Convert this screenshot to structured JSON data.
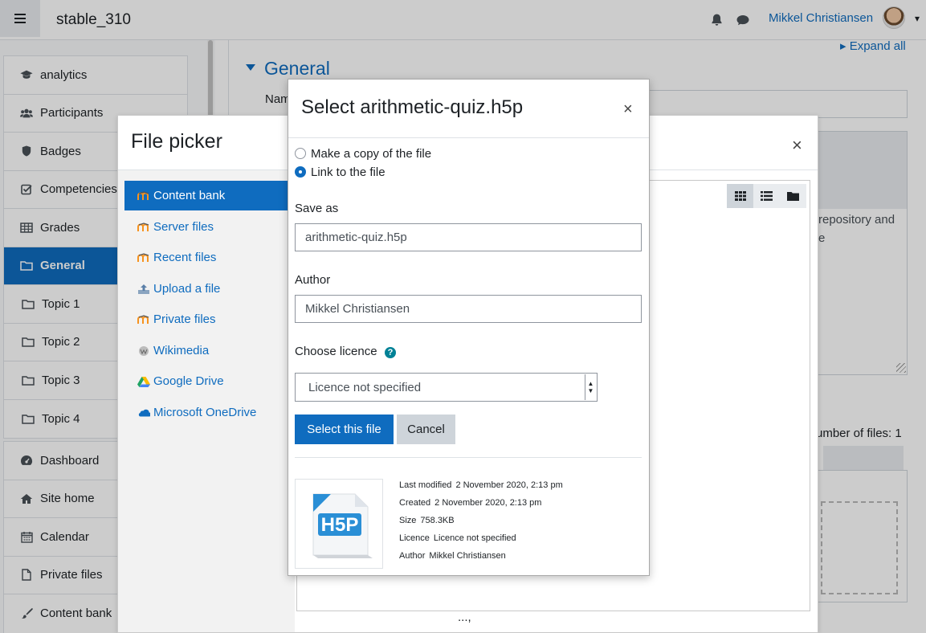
{
  "navbar": {
    "site_name": "stable_310",
    "user_name": "Mikkel Christiansen"
  },
  "drawer": {
    "course_items": [
      {
        "label": "analytics",
        "icon": "graduation-cap-icon"
      },
      {
        "label": "Participants",
        "icon": "users-icon"
      },
      {
        "label": "Badges",
        "icon": "shield-icon"
      },
      {
        "label": "Competencies",
        "icon": "checkbox-icon"
      },
      {
        "label": "Grades",
        "icon": "table-icon"
      },
      {
        "label": "General",
        "icon": "folder-icon",
        "active": true
      },
      {
        "label": "Topic 1",
        "icon": "folder-icon"
      },
      {
        "label": "Topic 2",
        "icon": "folder-icon"
      },
      {
        "label": "Topic 3",
        "icon": "folder-icon"
      },
      {
        "label": "Topic 4",
        "icon": "folder-icon"
      }
    ],
    "site_items": [
      {
        "label": "Dashboard",
        "icon": "dashboard-icon"
      },
      {
        "label": "Site home",
        "icon": "home-icon"
      },
      {
        "label": "Calendar",
        "icon": "calendar-icon"
      },
      {
        "label": "Private files",
        "icon": "file-icon"
      },
      {
        "label": "Content bank",
        "icon": "brush-icon"
      }
    ]
  },
  "page": {
    "expand_all": "Expand all",
    "section_title": "General",
    "name_label": "Nam",
    "bg_text_line1": "repository and",
    "bg_text_line2": "e",
    "max_files": "umber of files: 1",
    "footer_fragment": "...,"
  },
  "file_picker": {
    "title": "File picker",
    "close": "×",
    "repositories": [
      {
        "label": "Content bank",
        "icon": "moodle-icon",
        "active": true
      },
      {
        "label": "Server files",
        "icon": "moodle-icon"
      },
      {
        "label": "Recent files",
        "icon": "moodle-icon"
      },
      {
        "label": "Upload a file",
        "icon": "upload-icon"
      },
      {
        "label": "Private files",
        "icon": "moodle-icon"
      },
      {
        "label": "Wikimedia",
        "icon": "wikimedia-icon"
      },
      {
        "label": "Google Drive",
        "icon": "google-drive-icon"
      },
      {
        "label": "Microsoft OneDrive",
        "icon": "onedrive-icon"
      }
    ]
  },
  "select_dialog": {
    "title": "Select arithmetic-quiz.h5p",
    "close": "×",
    "option_copy": "Make a copy of the file",
    "option_link": "Link to the file",
    "selected_option": "link",
    "save_as_label": "Save as",
    "save_as_value": "arithmetic-quiz.h5p",
    "author_label": "Author",
    "author_value": "Mikkel Christiansen",
    "licence_label": "Choose licence",
    "licence_value": "Licence not specified",
    "select_button": "Select this file",
    "cancel_button": "Cancel",
    "file_icon": "h5p-icon",
    "details": [
      {
        "key": "Last modified",
        "value": "2 November 2020, 2:13 pm"
      },
      {
        "key": "Created",
        "value": "2 November 2020, 2:13 pm"
      },
      {
        "key": "Size",
        "value": "758.3KB"
      },
      {
        "key": "Licence",
        "value": "Licence not specified"
      },
      {
        "key": "Author",
        "value": "Mikkel Christiansen"
      }
    ]
  },
  "colors": {
    "primary": "#0f6cbf",
    "secondary": "#ced4da",
    "help": "#008196"
  }
}
